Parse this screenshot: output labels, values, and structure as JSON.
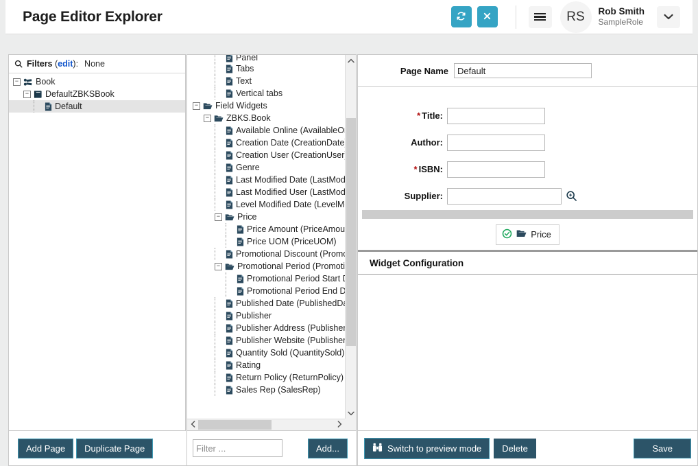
{
  "header": {
    "title": "Page Editor Explorer",
    "refresh_icon": "refresh-icon",
    "close_icon": "close-icon",
    "menu_icon": "hamburger-icon",
    "avatar_initials": "RS",
    "user_name": "Rob Smith",
    "user_role": "SampleRole",
    "caret_icon": "chevron-down-icon",
    "accent_color": "#35a4c4"
  },
  "left_panel": {
    "filters": {
      "search_icon": "search-icon",
      "label": "Filters",
      "edit_link": "edit",
      "colon": ":",
      "value": "None"
    },
    "tree": [
      {
        "label": "Book",
        "depth": 0,
        "toggle": "minus",
        "icon": "book-network-icon",
        "selected": false
      },
      {
        "label": "DefaultZBKSBook",
        "depth": 1,
        "toggle": "minus",
        "icon": "book-icon",
        "selected": false
      },
      {
        "label": "Default",
        "depth": 2,
        "toggle": "none",
        "icon": "page-icon",
        "selected": true
      }
    ],
    "footer": {
      "add_page_label": "Add Page",
      "duplicate_page_label": "Duplicate Page"
    }
  },
  "middle_panel": {
    "tree": [
      {
        "label": "Panel",
        "depth": 2,
        "toggle": "none",
        "icon": "page-icon",
        "clipped": true
      },
      {
        "label": "Tabs",
        "depth": 2,
        "toggle": "none",
        "icon": "page-icon"
      },
      {
        "label": "Text",
        "depth": 2,
        "toggle": "none",
        "icon": "page-icon"
      },
      {
        "label": "Vertical tabs",
        "depth": 2,
        "toggle": "none",
        "icon": "page-icon"
      },
      {
        "label": "Field Widgets",
        "depth": 0,
        "toggle": "minus",
        "icon": "folder-open-icon"
      },
      {
        "label": "ZBKS.Book",
        "depth": 1,
        "toggle": "minus",
        "icon": "folder-open-icon"
      },
      {
        "label": "Available Online (AvailableOnlin",
        "depth": 2,
        "toggle": "none",
        "icon": "page-icon"
      },
      {
        "label": "Creation Date (CreationDate)",
        "depth": 2,
        "toggle": "none",
        "icon": "page-icon"
      },
      {
        "label": "Creation User (CreationUser)",
        "depth": 2,
        "toggle": "none",
        "icon": "page-icon"
      },
      {
        "label": "Genre",
        "depth": 2,
        "toggle": "none",
        "icon": "page-icon"
      },
      {
        "label": "Last Modified Date (LastModifi",
        "depth": 2,
        "toggle": "none",
        "icon": "page-icon"
      },
      {
        "label": "Last Modified User (LastModifi",
        "depth": 2,
        "toggle": "none",
        "icon": "page-icon"
      },
      {
        "label": "Level Modified Date (LevelMod",
        "depth": 2,
        "toggle": "none",
        "icon": "page-icon"
      },
      {
        "label": "Price",
        "depth": 2,
        "toggle": "minus",
        "icon": "folder-open-icon"
      },
      {
        "label": "Price Amount (PriceAmount",
        "depth": 3,
        "toggle": "none",
        "icon": "page-icon"
      },
      {
        "label": "Price UOM (PriceUOM)",
        "depth": 3,
        "toggle": "none",
        "icon": "page-icon"
      },
      {
        "label": "Promotional Discount (Promoti",
        "depth": 2,
        "toggle": "none",
        "icon": "page-icon"
      },
      {
        "label": "Promotional Period (Promotion",
        "depth": 2,
        "toggle": "minus",
        "icon": "folder-open-icon"
      },
      {
        "label": "Promotional Period Start Da",
        "depth": 3,
        "toggle": "none",
        "icon": "page-icon"
      },
      {
        "label": "Promotional Period End Dat",
        "depth": 3,
        "toggle": "none",
        "icon": "page-icon"
      },
      {
        "label": "Published Date (PublishedDate",
        "depth": 2,
        "toggle": "none",
        "icon": "page-icon"
      },
      {
        "label": "Publisher",
        "depth": 2,
        "toggle": "none",
        "icon": "page-icon"
      },
      {
        "label": "Publisher Address (PublisherAd",
        "depth": 2,
        "toggle": "none",
        "icon": "page-icon"
      },
      {
        "label": "Publisher Website (PublisherWe",
        "depth": 2,
        "toggle": "none",
        "icon": "page-icon"
      },
      {
        "label": "Quantity Sold (QuantitySold)",
        "depth": 2,
        "toggle": "none",
        "icon": "page-icon"
      },
      {
        "label": "Rating",
        "depth": 2,
        "toggle": "none",
        "icon": "page-icon"
      },
      {
        "label": "Return Policy (ReturnPolicy)",
        "depth": 2,
        "toggle": "none",
        "icon": "page-icon"
      },
      {
        "label": "Sales Rep (SalesRep)",
        "depth": 2,
        "toggle": "none",
        "icon": "page-icon"
      }
    ],
    "footer": {
      "filter_placeholder": "Filter ...",
      "filter_value": "",
      "add_label": "Add..."
    }
  },
  "right_panel": {
    "page_name_label": "Page Name",
    "page_name_value": "Default",
    "fields": [
      {
        "label": "Title",
        "required": true,
        "value": "",
        "has_lookup": false
      },
      {
        "label": "Author",
        "required": false,
        "value": "",
        "has_lookup": false
      },
      {
        "label": "ISBN",
        "required": true,
        "value": "",
        "has_lookup": false
      },
      {
        "label": "Supplier",
        "required": false,
        "value": "",
        "has_lookup": true
      }
    ],
    "widget_chip": {
      "status_icon": "check-circle-icon",
      "folder_icon": "folder-open-icon",
      "label": "Price"
    },
    "config_title": "Widget Configuration",
    "footer": {
      "preview_icon": "binoculars-icon",
      "preview_label": "Switch to preview mode",
      "delete_label": "Delete",
      "save_label": "Save"
    }
  },
  "colors": {
    "accent": "#35a4c4",
    "button_dark": "#2c5468",
    "required": "#b10e0e",
    "link": "#1155cc",
    "success": "#18a558"
  }
}
